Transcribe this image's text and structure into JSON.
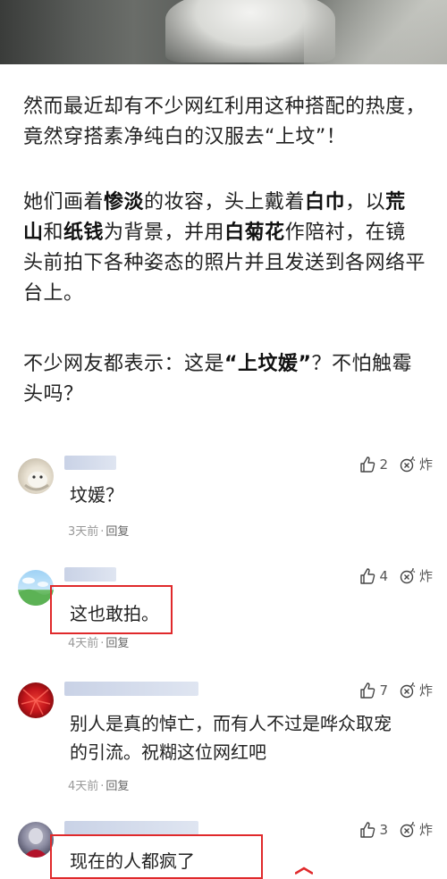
{
  "article": {
    "paragraph1": "然而最近却有不少网红利用这种搭配的热度，竟然穿搭素净纯白的汉服去“上坟”！",
    "paragraph2": {
      "seg1": "她们画着",
      "bold1": "惨淡",
      "seg2": "的妆容，头上戴着",
      "bold2": "白巾",
      "seg3": "，以",
      "bold3": "荒山",
      "seg4": "和",
      "bold4": "纸钱",
      "seg5": "为背景，并用",
      "bold5": "白菊花",
      "seg6": "作陪衬，在镜头前拍下各种姿态的照片并且发送到各网络平台上。"
    },
    "paragraph3": {
      "seg1": "不少网友都表示：这是",
      "bold1": "“上坟媛”",
      "seg2": "？不怕触霉头吗？"
    }
  },
  "comments": [
    {
      "text": "坟媛？",
      "time": "3天前",
      "reply": "回复",
      "likes": "2",
      "bomb": "炸"
    },
    {
      "text": "这也敢拍。",
      "time": "4天前",
      "reply": "回复",
      "likes": "4",
      "bomb": "炸"
    },
    {
      "text_line1": "别人是真的悼亡，而有人不过是哗众取宠",
      "text_line2": "的引流。祝糊这位网红吧",
      "time": "4天前",
      "reply": "回复",
      "likes": "7",
      "bomb": "炸"
    },
    {
      "text": "现在的人都疯了",
      "likes": "3",
      "bomb": "炸"
    }
  ],
  "meta_separator": "·",
  "colors": {
    "highlight": "#e0292b",
    "meta": "#999999",
    "name_blur": "#c9d2e6"
  },
  "icons": [
    "thumb-up-icon",
    "bomb-icon"
  ]
}
